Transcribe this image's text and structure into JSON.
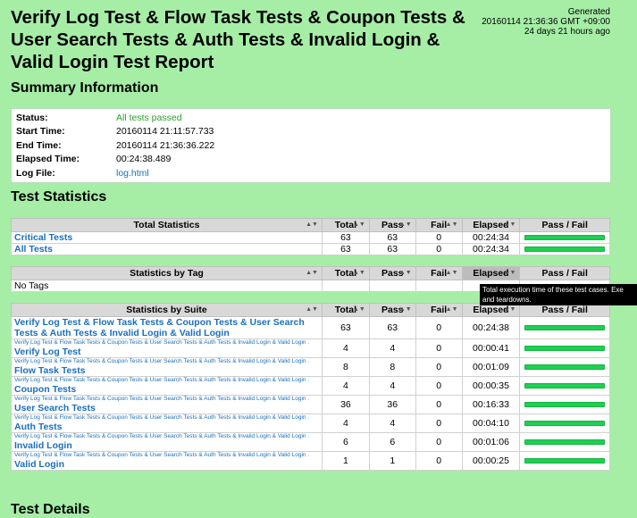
{
  "header": {
    "title": "Verify Log Test & Flow Task Tests & Coupon Tests & User Search Tests & Auth Tests & Invalid Login & Valid Login Test Report",
    "generated_label": "Generated",
    "generated_time": "20160114 21:36:36 GMT +09:00",
    "generated_ago": "24 days 21 hours ago"
  },
  "summary": {
    "heading": "Summary Information",
    "rows": [
      {
        "key": "Status:",
        "value": "All tests passed"
      },
      {
        "key": "Start Time:",
        "value": "20160114 21:11:57.733"
      },
      {
        "key": "End Time:",
        "value": "20160114 21:36:36.222"
      },
      {
        "key": "Elapsed Time:",
        "value": "00:24:38.489"
      },
      {
        "key": "Log File:",
        "value": "log.html"
      }
    ]
  },
  "statistics": {
    "heading": "Test Statistics",
    "columns": {
      "total": "Total",
      "pass": "Pass",
      "fail": "Fail",
      "elapsed": "Elapsed",
      "passfail": "Pass / Fail"
    },
    "total": {
      "title": "Total Statistics",
      "rows": [
        {
          "name": "Critical Tests",
          "total": "63",
          "pass": "63",
          "fail": "0",
          "elapsed": "00:24:34",
          "ratio": 1.0
        },
        {
          "name": "All Tests",
          "total": "63",
          "pass": "63",
          "fail": "0",
          "elapsed": "00:24:34",
          "ratio": 1.0
        }
      ]
    },
    "tag": {
      "title": "Statistics by Tag",
      "empty": "No Tags"
    },
    "suite": {
      "title": "Statistics by Suite",
      "parent": "Verify Log Test & Flow Task Tests & Coupon Tests & User Search Tests & Auth Tests & Invalid Login & Valid Login .",
      "top": {
        "name": "Verify Log Test & Flow Task Tests & Coupon Tests & User Search Tests & Auth Tests & Invalid Login & Valid Login",
        "total": "63",
        "pass": "63",
        "fail": "0",
        "elapsed": "00:24:38",
        "ratio": 1.0
      },
      "rows": [
        {
          "name": "Verify Log Test",
          "total": "4",
          "pass": "4",
          "fail": "0",
          "elapsed": "00:00:41",
          "ratio": 1.0
        },
        {
          "name": "Flow Task Tests",
          "total": "8",
          "pass": "8",
          "fail": "0",
          "elapsed": "00:01:09",
          "ratio": 1.0
        },
        {
          "name": "Coupon Tests",
          "total": "4",
          "pass": "4",
          "fail": "0",
          "elapsed": "00:00:35",
          "ratio": 1.0
        },
        {
          "name": "User Search Tests",
          "total": "36",
          "pass": "36",
          "fail": "0",
          "elapsed": "00:16:33",
          "ratio": 1.0
        },
        {
          "name": "Auth Tests",
          "total": "4",
          "pass": "4",
          "fail": "0",
          "elapsed": "00:04:10",
          "ratio": 1.0
        },
        {
          "name": "Invalid Login",
          "total": "6",
          "pass": "6",
          "fail": "0",
          "elapsed": "00:01:06",
          "ratio": 1.0
        },
        {
          "name": "Valid Login",
          "total": "1",
          "pass": "1",
          "fail": "0",
          "elapsed": "00:00:25",
          "ratio": 1.0
        }
      ]
    }
  },
  "tooltip": {
    "line1": "Total execution time of these test cases. Exe",
    "line2": "and teardowns."
  },
  "details": {
    "heading": "Test Details"
  },
  "icons": {
    "sort": "sort-arrows-icon"
  }
}
